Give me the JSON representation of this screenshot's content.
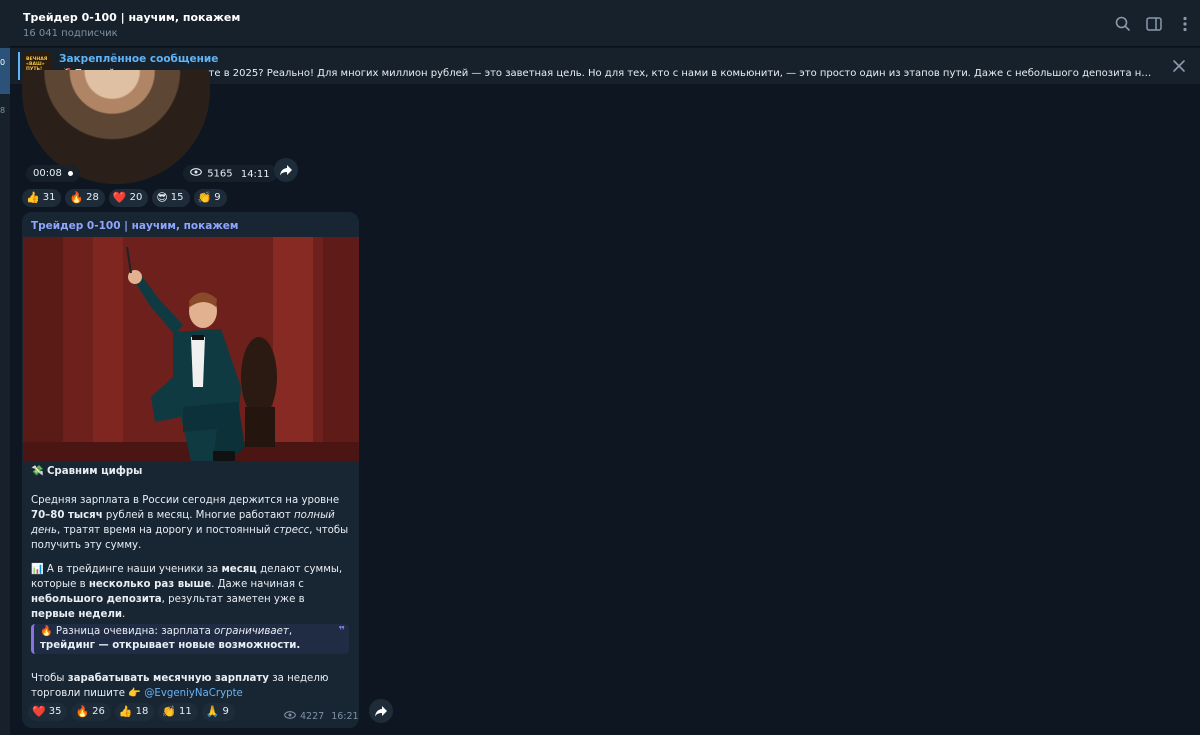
{
  "sidebar_strip": {
    "numbers": [
      "0",
      "8"
    ]
  },
  "header": {
    "title": "Трейдер 0-100 | научим, покажем",
    "subscribers": "16 041 подписчик",
    "icons": [
      "search-icon",
      "sidebar-toggle-icon",
      "more-icon"
    ]
  },
  "pinned": {
    "label": "Закреплённое сообщение",
    "thumb_text": "ВЕЧНАЯ\n«ВАШ»\nПУТЬ!",
    "text": "🚀 Первый миллион на крипте в 2025? Реально!  Для многих миллион рублей — это заветная цель. Но для тех, кто с нами в комьюнити, — это просто один из этапов пути. Даже с небольшого депозита наши ребята выходя..."
  },
  "video_message": {
    "duration": "00:08",
    "views": "5165",
    "time": "14:11",
    "reactions": [
      {
        "emoji": "👍",
        "count": "31"
      },
      {
        "emoji": "🔥",
        "count": "28"
      },
      {
        "emoji": "❤️",
        "count": "20"
      },
      {
        "emoji": "😎",
        "count": "15"
      },
      {
        "emoji": "👏",
        "count": "9"
      }
    ]
  },
  "post": {
    "author": "Трейдер 0-100 | научим, покажем",
    "heading_emoji": "💸",
    "heading": "Сравним цифры",
    "p1": {
      "a": "Средняя зарплата в России сегодня держится на уровне ",
      "b": "70–80 тысяч",
      "c": " рублей в месяц. Многие работают ",
      "d": "полный день",
      "e": ", тратят время на дорогу и постоянный ",
      "f": "стресс",
      "g": ", чтобы получить эту сумму."
    },
    "p2": {
      "emoji": "📊",
      "a": " А в трейдинге наши ученики за ",
      "b": "месяц",
      "c": " делают суммы, которые в ",
      "d": "несколько раз выше",
      "e": ". Даже начиная с ",
      "f": "небольшого депозита",
      "g": ", результат заметен уже в ",
      "h": "первые недели",
      "i": "."
    },
    "quote": {
      "emoji": "🔥",
      "a": " Разница очевидна: зарплата ",
      "b": "ограничивает",
      "c": ", ",
      "d": "трейдинг — открывает новые возможности.",
      "mark": "❞"
    },
    "p3": {
      "a": "Чтобы ",
      "b": "зарабатывать месячную зарплату",
      "c": " за неделю торговли пишите ",
      "emoji": "👉",
      "link": "@EvgeniyNaCrypte"
    },
    "reactions": [
      {
        "emoji": "❤️",
        "count": "35"
      },
      {
        "emoji": "🔥",
        "count": "26"
      },
      {
        "emoji": "👍",
        "count": "18"
      },
      {
        "emoji": "👏",
        "count": "11"
      },
      {
        "emoji": "🙏",
        "count": "9"
      }
    ],
    "views": "4227",
    "time": "16:21"
  },
  "colors": {
    "background": "#0e1621",
    "panel": "#17212b",
    "bubble": "#182533",
    "accent": "#5eb5f7",
    "author": "#8fa6ff",
    "quote_border": "#8774e1"
  }
}
